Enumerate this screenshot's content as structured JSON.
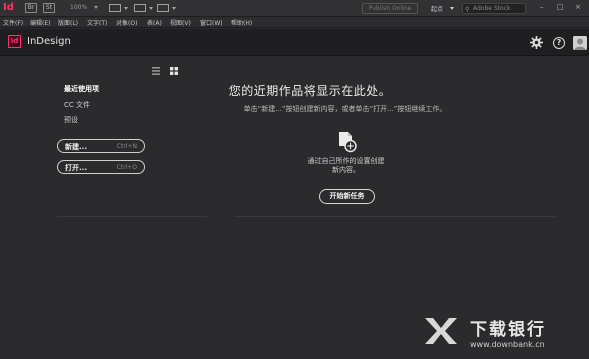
{
  "appbar": {
    "logo": "Id",
    "bridge": "Br",
    "stock": "St",
    "zoom": "100%",
    "publish": "Publish Online",
    "workspace": "起点",
    "stock_search_placeholder": "Adobe Stock",
    "window_controls": [
      "–",
      "□",
      "×"
    ]
  },
  "menubar": {
    "items": [
      "文件(F)",
      "编辑(E)",
      "版面(L)",
      "文字(T)",
      "对象(O)",
      "表(A)",
      "视图(V)",
      "窗口(W)",
      "帮助(H)"
    ]
  },
  "titlebar": {
    "icon_label": "Id",
    "app_name": "InDesign"
  },
  "sidebar": {
    "nav": [
      {
        "label": "最近使用项",
        "active": true
      },
      {
        "label": "CC 文件",
        "active": false
      },
      {
        "label": "预设",
        "active": false
      }
    ],
    "new_button": {
      "label": "新建...",
      "shortcut": "Ctrl+N"
    },
    "open_button": {
      "label": "打开...",
      "shortcut": "Ctrl+O"
    }
  },
  "main": {
    "heading": "您的近期作品将显示在此处。",
    "subtext": "单击“新建...”按钮创建新内容，或者单击“打开...”按钮继续工作。",
    "hint_line1": "通过自己所作的设置创建",
    "hint_line2": "新内容。",
    "start_button": "开始新任务"
  },
  "watermark": {
    "title": "下载银行",
    "url": "www.downbank.cn"
  },
  "colors": {
    "background": "#2b2a2d",
    "titlebar": "#1f1e21",
    "accent": "#ff3366"
  }
}
